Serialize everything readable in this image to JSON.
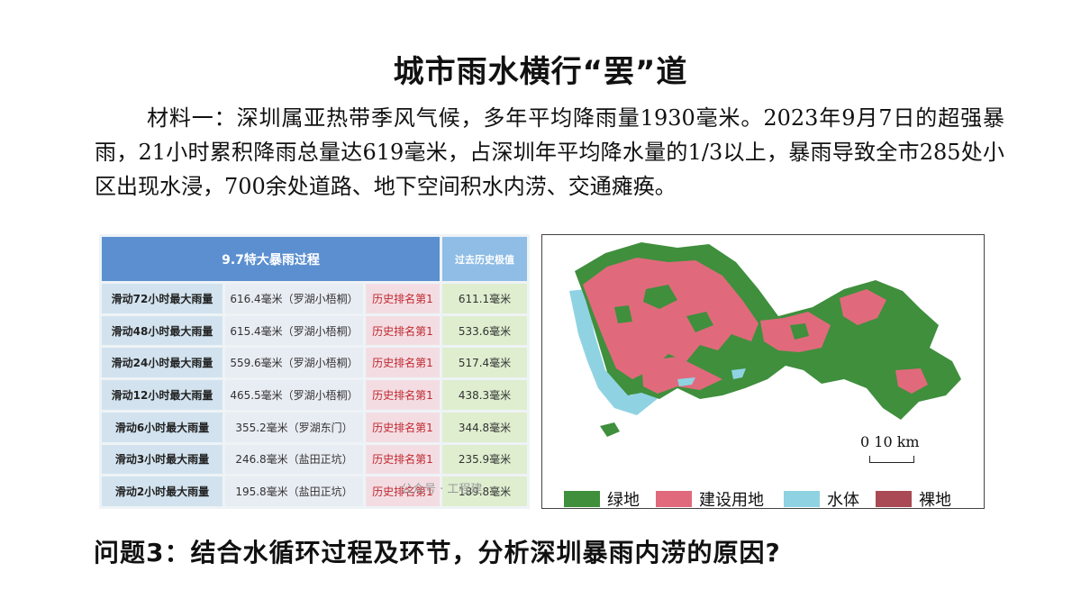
{
  "title": "城市雨水横行“罢”道",
  "material": "材料一：深圳属亚热带季风气候，多年平均降雨量1930毫米。2023年9月7日的超强暴雨，21小时累积降雨总量达619毫米，占深圳年平均降水量的1/3以上，暴雨导致全市285处小区出现水浸，700余处道路、地下空间积水内涝、交通瘫痪。",
  "table": {
    "header_main": "9.7特大暴雨过程",
    "header_hist": "过去历史极值",
    "rows": [
      {
        "label": "滑动72小时最大雨量",
        "value": "616.4毫米（罗湖小梧桐）",
        "rank": "历史排名第1",
        "hist": "611.1毫米"
      },
      {
        "label": "滑动48小时最大雨量",
        "value": "615.4毫米（罗湖小梧桐）",
        "rank": "历史排名第1",
        "hist": "533.6毫米"
      },
      {
        "label": "滑动24小时最大雨量",
        "value": "559.6毫米（罗湖小梧桐）",
        "rank": "历史排名第1",
        "hist": "517.4毫米"
      },
      {
        "label": "滑动12小时最大雨量",
        "value": "465.5毫米（罗湖小梧桐）",
        "rank": "历史排名第1",
        "hist": "438.3毫米"
      },
      {
        "label": "滑动6小时最大雨量",
        "value": "355.2毫米（罗湖东门）",
        "rank": "历史排名第1",
        "hist": "344.8毫米"
      },
      {
        "label": "滑动3小时最大雨量",
        "value": "246.8毫米（盐田正坑）",
        "rank": "历史排名第1",
        "hist": "235.9毫米"
      },
      {
        "label": "滑动2小时最大雨量",
        "value": "195.8毫米（盐田正坑）",
        "rank": "历史排名第1",
        "hist": "189.8毫米"
      }
    ]
  },
  "watermark": "公众号 · 工程建",
  "map": {
    "scale_label": "0  10 km",
    "legend": [
      {
        "label": "绿地",
        "color": "#3f8f3d"
      },
      {
        "label": "建设用地",
        "color": "#e06a7c"
      },
      {
        "label": "水体",
        "color": "#8fd3e3"
      },
      {
        "label": "裸地",
        "color": "#a94a55"
      }
    ]
  },
  "question": "问题3：结合水循环过程及环节，分析深圳暴雨内涝的原因?"
}
